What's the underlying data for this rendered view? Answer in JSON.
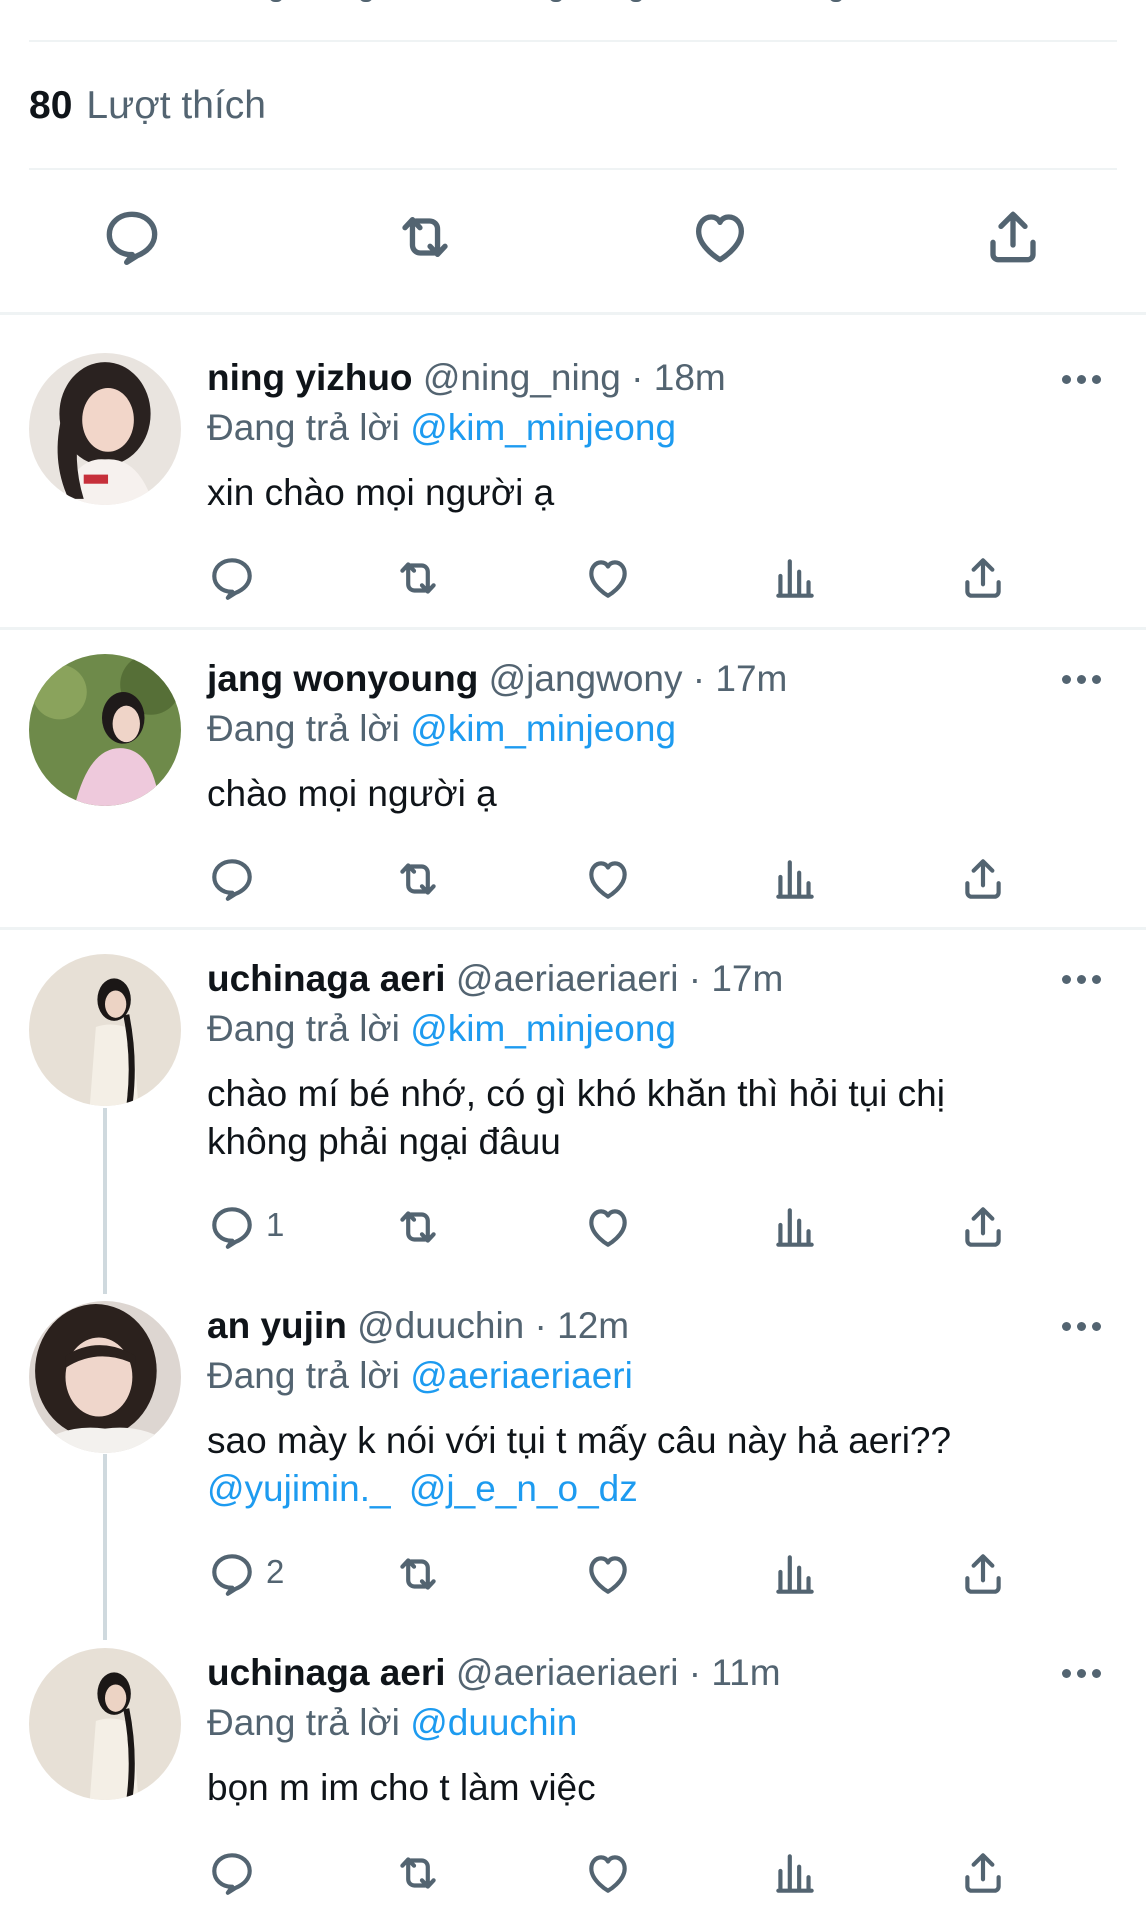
{
  "tweet_stats": {
    "likes_count": "80",
    "likes_label": "Lượt thích"
  },
  "main_actions": [
    {
      "icon": "reply-icon"
    },
    {
      "icon": "retweet-icon"
    },
    {
      "icon": "like-icon"
    },
    {
      "icon": "share-icon"
    }
  ],
  "replies": [
    {
      "name": "ning yizhuo",
      "handle": "@ning_ning",
      "time": "· 18m",
      "replying_label": "Đang trả lời",
      "replying_to": "@kim_minjeong",
      "text": "xin chào mọi người ạ",
      "reply_count": ""
    },
    {
      "name": "jang wonyoung",
      "handle": "@jangwony",
      "time": "· 17m",
      "replying_label": "Đang trả lời",
      "replying_to": "@kim_minjeong",
      "text": "chào mọi người ạ",
      "reply_count": ""
    },
    {
      "name": "uchinaga aeri",
      "handle": "@aeriaeriaeri",
      "time": "· 17m",
      "replying_label": "Đang trả lời",
      "replying_to": "@kim_minjeong",
      "text_line1": "chào mí bé nhớ, có gì khó khăn thì hỏi tụi chị",
      "text_line2": "không phải ngại đâuu",
      "reply_count": "1"
    },
    {
      "name": "an yujin",
      "handle": "@duuchin",
      "time": "· 12m",
      "replying_label": "Đang trả lời",
      "replying_to": "@aeriaeriaeri",
      "text_line1": "sao mày k nói với tụi t mấy câu này hả aeri??",
      "mention1": "@yujimin._",
      "mention2": "@j_e_n_o_dz",
      "reply_count": "2"
    },
    {
      "name": "uchinaga aeri",
      "handle": "@aeriaeriaeri",
      "time": "· 11m",
      "replying_label": "Đang trả lời",
      "replying_to": "@duuchin",
      "text": "bọn m im cho t làm việc",
      "reply_count": ""
    }
  ],
  "colors": {
    "text": "#0f1419",
    "secondary": "#536471",
    "link": "#1d9bf0",
    "divider": "#eff3f4"
  }
}
